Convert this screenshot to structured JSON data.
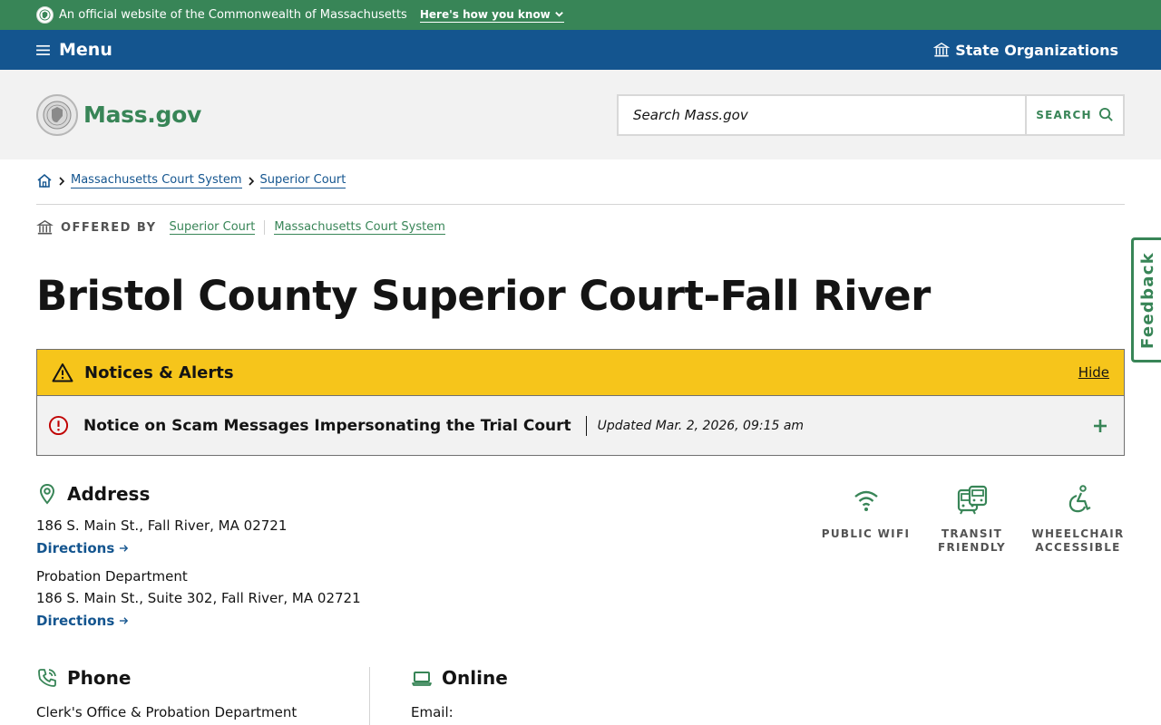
{
  "banner": {
    "official_text": "An official website of the Commonwealth of Massachusetts",
    "how_you_know": "Here's how you know"
  },
  "menubar": {
    "menu_label": "Menu",
    "state_orgs_label": "State Organizations"
  },
  "header": {
    "logo_text": "Mass.gov",
    "search_placeholder": "Search Mass.gov",
    "search_button": "SEARCH"
  },
  "breadcrumb": {
    "items": [
      "Massachusetts Court System",
      "Superior Court"
    ]
  },
  "offered_by": {
    "label": "OFFERED BY",
    "orgs": [
      "Superior Court",
      "Massachusetts Court System"
    ]
  },
  "page_title": "Bristol County Superior Court-Fall River",
  "alerts": {
    "heading": "Notices & Alerts",
    "hide_label": "Hide",
    "item_title": "Notice on Scam Messages Impersonating the Trial Court",
    "item_updated": "Updated Mar. 2, 2026, 09:15 am"
  },
  "address": {
    "heading": "Address",
    "main_address": "186 S. Main St., Fall River, MA 02721",
    "directions_label": "Directions",
    "probation_name": "Probation Department",
    "probation_address": "186 S. Main St., Suite 302, Fall River, MA 02721"
  },
  "amenities": [
    {
      "icon": "wifi-icon",
      "label": "PUBLIC WIFI"
    },
    {
      "icon": "transit-icon",
      "label": "TRANSIT FRIENDLY"
    },
    {
      "icon": "wheelchair-icon",
      "label": "WHEELCHAIR ACCESSIBLE"
    }
  ],
  "phone": {
    "heading": "Phone",
    "sub": "Clerk's Office & Probation Department"
  },
  "online": {
    "heading": "Online",
    "sub": "Email:"
  },
  "feedback_label": "Feedback",
  "colors": {
    "green": "#388557",
    "blue": "#14558f",
    "alert_yellow": "#f6c51b",
    "alert_red": "#c00000"
  }
}
